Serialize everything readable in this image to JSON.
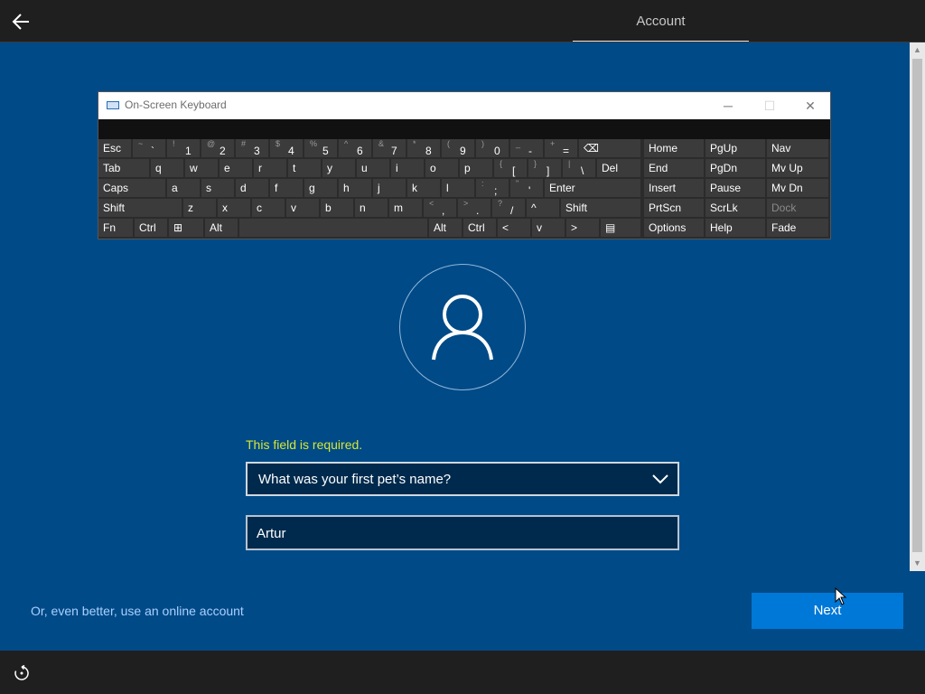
{
  "header": {
    "tab_label": "Account"
  },
  "keyboard": {
    "title": "On-Screen Keyboard",
    "controls": {
      "minimize": "─",
      "maximize": "☐",
      "close": "✕"
    },
    "row1": [
      {
        "m": "Esc"
      },
      {
        "t": "~",
        "b": "`"
      },
      {
        "t": "!",
        "b": "1"
      },
      {
        "t": "@",
        "b": "2"
      },
      {
        "t": "#",
        "b": "3"
      },
      {
        "t": "$",
        "b": "4"
      },
      {
        "t": "%",
        "b": "5"
      },
      {
        "t": "^",
        "b": "6"
      },
      {
        "t": "&",
        "b": "7"
      },
      {
        "t": "*",
        "b": "8"
      },
      {
        "t": "(",
        "b": "9"
      },
      {
        "t": ")",
        "b": "0"
      },
      {
        "t": "_",
        "b": "-"
      },
      {
        "t": "+",
        "b": "="
      },
      {
        "m": "⌫"
      }
    ],
    "row2": [
      {
        "m": "Tab"
      },
      {
        "m": "q"
      },
      {
        "m": "w"
      },
      {
        "m": "e"
      },
      {
        "m": "r"
      },
      {
        "m": "t"
      },
      {
        "m": "y"
      },
      {
        "m": "u"
      },
      {
        "m": "i"
      },
      {
        "m": "o"
      },
      {
        "m": "p"
      },
      {
        "t": "{",
        "b": "["
      },
      {
        "t": "}",
        "b": "]"
      },
      {
        "t": "|",
        "b": "\\"
      },
      {
        "m": "Del"
      }
    ],
    "row3": [
      {
        "m": "Caps"
      },
      {
        "m": "a"
      },
      {
        "m": "s"
      },
      {
        "m": "d"
      },
      {
        "m": "f"
      },
      {
        "m": "g"
      },
      {
        "m": "h"
      },
      {
        "m": "j"
      },
      {
        "m": "k"
      },
      {
        "m": "l"
      },
      {
        "t": ":",
        "b": ";"
      },
      {
        "t": "\"",
        "b": "'"
      },
      {
        "m": "Enter"
      }
    ],
    "row4": [
      {
        "m": "Shift"
      },
      {
        "m": "z"
      },
      {
        "m": "x"
      },
      {
        "m": "c"
      },
      {
        "m": "v"
      },
      {
        "m": "b"
      },
      {
        "m": "n"
      },
      {
        "m": "m"
      },
      {
        "t": "<",
        "b": ","
      },
      {
        "t": ">",
        "b": "."
      },
      {
        "t": "?",
        "b": "/"
      },
      {
        "m": "^"
      },
      {
        "m": "Shift"
      }
    ],
    "row5": [
      {
        "m": "Fn"
      },
      {
        "m": "Ctrl"
      },
      {
        "m": "⊞"
      },
      {
        "m": "Alt"
      },
      {
        "m": ""
      },
      {
        "m": "Alt"
      },
      {
        "m": "Ctrl"
      },
      {
        "m": "<"
      },
      {
        "m": "v"
      },
      {
        "m": ">"
      },
      {
        "m": "▤"
      }
    ],
    "nav": [
      {
        "m": "Home"
      },
      {
        "m": "PgUp"
      },
      {
        "m": "Nav"
      },
      {
        "m": "End"
      },
      {
        "m": "PgDn"
      },
      {
        "m": "Mv Up"
      },
      {
        "m": "Insert"
      },
      {
        "m": "Pause"
      },
      {
        "m": "Mv Dn"
      },
      {
        "m": "PrtScn"
      },
      {
        "m": "ScrLk"
      },
      {
        "m": "Dock"
      },
      {
        "m": "Options"
      },
      {
        "m": "Help"
      },
      {
        "m": "Fade"
      }
    ]
  },
  "form": {
    "error_message": "This field is required.",
    "question_selected": "What was your first pet’s name?",
    "answer_value": "Artur"
  },
  "footer": {
    "online_account_link": "Or, even better, use an online account",
    "next_label": "Next"
  },
  "scrollbar": {
    "up_glyph": "▲",
    "down_glyph": "▼"
  },
  "colors": {
    "background": "#004a87",
    "accent": "#0078d7",
    "error": "#d5e736",
    "link": "#aad0ff"
  }
}
